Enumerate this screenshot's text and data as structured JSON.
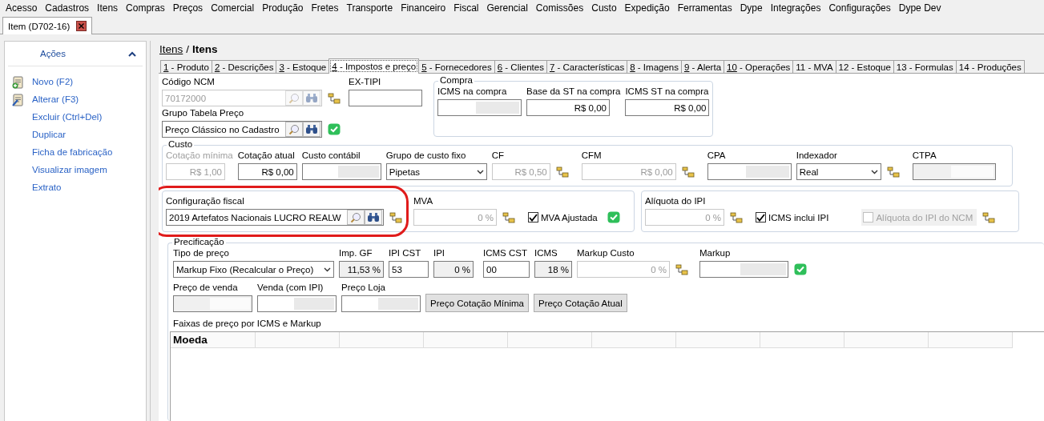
{
  "menu": [
    "Acesso",
    "Cadastros",
    "Itens",
    "Compras",
    "Preços",
    "Comercial",
    "Produção",
    "Fretes",
    "Transporte",
    "Financeiro",
    "Fiscal",
    "Gerencial",
    "Comissões",
    "Custo",
    "Expedição",
    "Ferramentas",
    "Dype",
    "Integrações",
    "Configurações",
    "Dype Dev"
  ],
  "document_tab": {
    "title": "Item (D702-16)",
    "selected": true
  },
  "sidebar": {
    "title": "Ações",
    "expanded": true,
    "actions": [
      {
        "label": "Novo (F2)",
        "kind": "new"
      },
      {
        "label": "Alterar (F3)",
        "kind": "edit"
      },
      {
        "label": "Excluir (Ctrl+Del)",
        "kind": "plain"
      },
      {
        "label": "Duplicar",
        "kind": "plain"
      },
      {
        "label": "Ficha de fabricação",
        "kind": "plain"
      },
      {
        "label": "Visualizar imagem",
        "kind": "plain"
      },
      {
        "label": "Extrato",
        "kind": "plain"
      }
    ]
  },
  "breadcrumb": {
    "parent": "Itens",
    "separator": "/",
    "current": "Itens"
  },
  "tabs": [
    {
      "number": "1",
      "title": "- Produto",
      "mnemonic": true,
      "selected": false
    },
    {
      "number": "2",
      "title": "- Descrições",
      "mnemonic": true,
      "selected": false
    },
    {
      "number": "3",
      "title": "- Estoque",
      "mnemonic": true,
      "selected": false
    },
    {
      "number": "4",
      "title": "- Impostos e preço",
      "mnemonic": true,
      "selected": true
    },
    {
      "number": "5",
      "title": "- Fornecedores",
      "mnemonic": true,
      "selected": false
    },
    {
      "number": "6",
      "title": "- Clientes",
      "mnemonic": true,
      "selected": false
    },
    {
      "number": "7",
      "title": "- Características",
      "mnemonic": true,
      "selected": false
    },
    {
      "number": "8",
      "title": "- Imagens",
      "mnemonic": true,
      "selected": false
    },
    {
      "number": "9",
      "title": "- Alerta",
      "mnemonic": true,
      "selected": false
    },
    {
      "number": "10",
      "title": "- Operações",
      "mnemonic": true,
      "selected": false
    },
    {
      "number": "11",
      "title": "- MVA",
      "mnemonic": false,
      "selected": false
    },
    {
      "number": "12",
      "title": "- Estoque",
      "mnemonic": false,
      "selected": false
    },
    {
      "number": "13",
      "title": "- Formulas",
      "mnemonic": false,
      "selected": false
    },
    {
      "number": "14",
      "title": "- Produções",
      "mnemonic": false,
      "selected": false
    }
  ],
  "ncm": {
    "fields": [
      {
        "kind": "lookup",
        "label": "Código NCM",
        "value": "70172000",
        "disabled": true,
        "link": true
      },
      {
        "kind": "text",
        "label": "EX-TIPI",
        "disabled": false
      }
    ]
  },
  "price_group": {
    "fields": [
      {
        "kind": "lookup",
        "label": "Grupo Tabela Preço",
        "value": "Preço Clássico no Cadastro",
        "disabled": false,
        "ok": true
      }
    ]
  },
  "compra": {
    "title": "Compra",
    "fields": [
      {
        "kind": "text",
        "label": "ICMS na compra",
        "disabled": false,
        "redacted": true
      },
      {
        "kind": "numeric",
        "label": "Base da ST na compra",
        "value": "R$ 0,00",
        "disabled": false
      },
      {
        "kind": "numeric",
        "label": "ICMS ST na compra",
        "value": "R$ 0,00",
        "disabled": false
      }
    ]
  },
  "custo": {
    "title": "Custo",
    "fields": [
      {
        "kind": "numeric",
        "label": "Cotação mínima",
        "label_disabled": true,
        "value": "R$ 1,00",
        "disabled": true
      },
      {
        "kind": "numeric",
        "label": "Cotação atual",
        "value": "R$ 0,00",
        "disabled": false
      },
      {
        "kind": "text",
        "label": "Custo contábil",
        "disabled": false,
        "redacted": true
      },
      {
        "kind": "select",
        "label": "Grupo de custo fixo",
        "value": "Pipetas",
        "disabled": false
      },
      {
        "kind": "numeric",
        "label": "CF",
        "value": "R$ 0,50",
        "disabled": true,
        "link": true
      },
      {
        "kind": "numeric",
        "label": "CFM",
        "value": "R$ 0,00",
        "disabled": true,
        "link": true
      },
      {
        "kind": "text",
        "label": "CPA",
        "disabled": false,
        "redacted": true
      },
      {
        "kind": "select",
        "label": "Indexador",
        "value": "Real",
        "disabled": false,
        "link": true
      },
      {
        "kind": "readonly",
        "label": "CTPA",
        "disabled": false,
        "redacted": true
      }
    ]
  },
  "fiscal": {
    "highlighted": true,
    "fields": [
      {
        "kind": "lookup",
        "label": "Configuração fiscal",
        "value": "2019 Artefatos Nacionais LUCRO REALW",
        "disabled": false,
        "link": true
      },
      {
        "kind": "numeric",
        "label": "MVA",
        "value": "0 %",
        "disabled": true,
        "link": true
      },
      {
        "kind": "check",
        "label": "MVA Ajustada",
        "checked": true,
        "disabled": false,
        "ok": true
      }
    ]
  },
  "ipi": {
    "fields": [
      {
        "kind": "numeric",
        "label": "Alíquota do IPI",
        "value": "0 %",
        "disabled": true,
        "link": true
      },
      {
        "kind": "check",
        "label": "ICMS inclui IPI",
        "checked": true,
        "disabled": false
      },
      {
        "kind": "check",
        "label": "Alíquota do IPI do NCM",
        "checked": false,
        "disabled": true,
        "link": true
      }
    ]
  },
  "precificacao": {
    "title": "Precificação",
    "fields": [
      {
        "kind": "select",
        "label": "Tipo de preço",
        "value": "Markup Fixo (Recalcular o Preço)",
        "disabled": false
      },
      {
        "kind": "readonly",
        "label": "Imp. GF",
        "value": "11,53 %",
        "disabled": false
      },
      {
        "kind": "text",
        "label": "IPI CST",
        "value": "53",
        "disabled": false
      },
      {
        "kind": "readonly",
        "label": "IPI",
        "value": "0 %",
        "disabled": false
      },
      {
        "kind": "text",
        "label": "ICMS CST",
        "value": "00",
        "disabled": false
      },
      {
        "kind": "readonly",
        "label": "ICMS",
        "value": "18 %",
        "disabled": false
      },
      {
        "kind": "numeric",
        "label": "Markup Custo",
        "value": "0 %",
        "disabled": true,
        "link": true
      },
      {
        "kind": "text",
        "label": "Markup",
        "disabled": false,
        "redacted": true,
        "ok": true
      }
    ],
    "prices": [
      {
        "kind": "readonly",
        "label": "Preço de venda",
        "disabled": false,
        "redacted": true
      },
      {
        "kind": "text",
        "label": "Venda (com IPI)",
        "disabled": false,
        "redacted": true
      },
      {
        "kind": "text",
        "label": "Preço Loja",
        "disabled": false,
        "redacted": true
      },
      {
        "kind": "button",
        "value": "Preço Cotação Mínima"
      },
      {
        "kind": "button",
        "value": "Preço Cotação Atual"
      }
    ],
    "table": {
      "title": "Faixas de preço por ICMS e Markup",
      "columns": [
        "Moeda"
      ]
    }
  }
}
